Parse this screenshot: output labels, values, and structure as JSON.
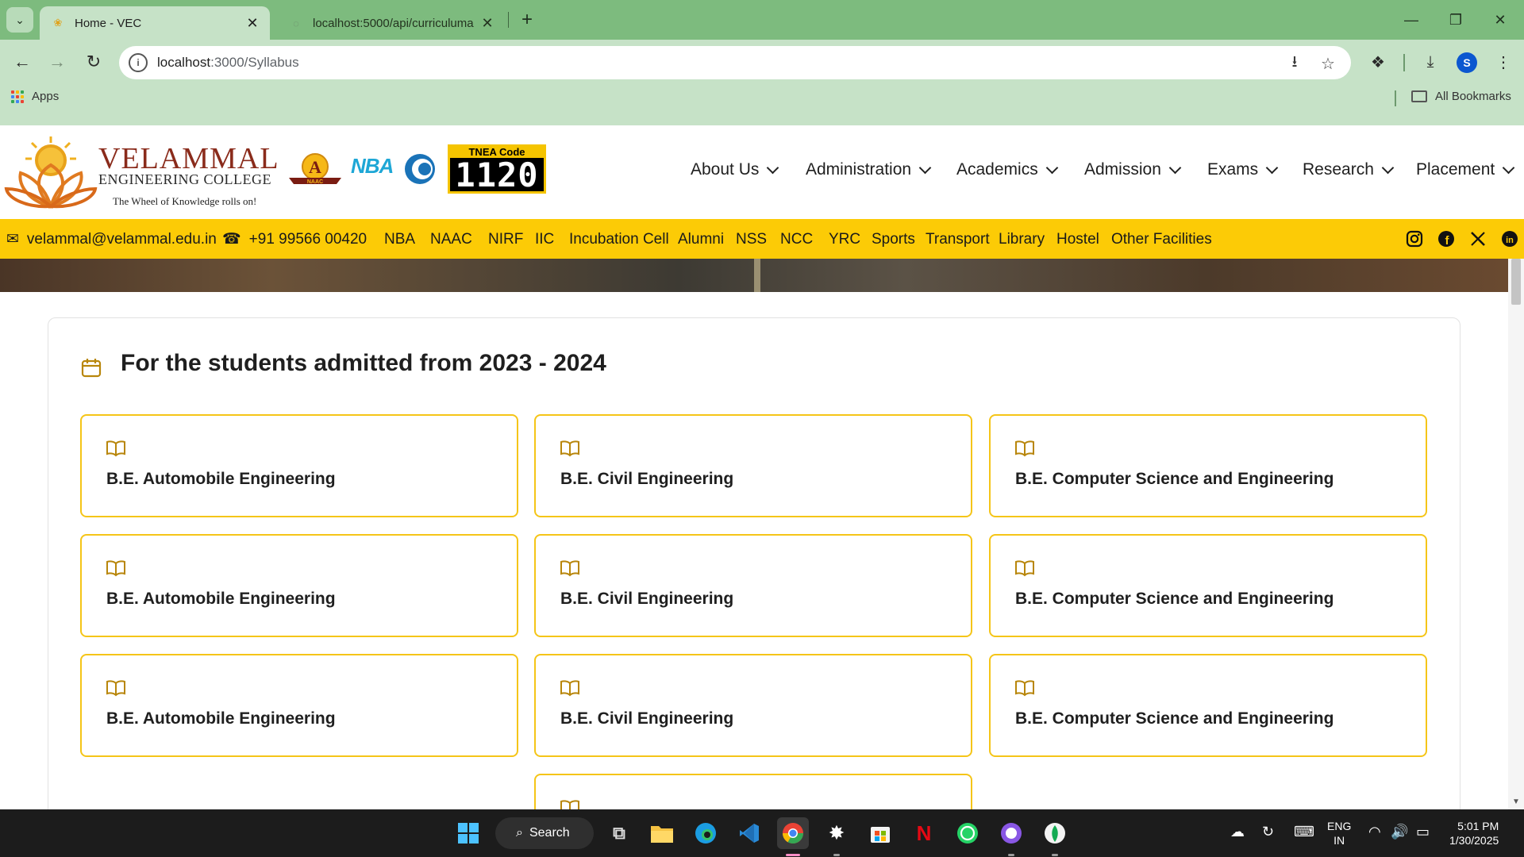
{
  "browser": {
    "tabs": [
      {
        "title": "Home - VEC",
        "active": true
      },
      {
        "title": "localhost:5000/api/curriculuma",
        "active": false
      }
    ],
    "url_host": "localhost",
    "url_path": ":3000/Syllabus",
    "bookmarks": {
      "apps_label": "Apps",
      "all_label": "All Bookmarks"
    },
    "profile_initial": "S"
  },
  "site": {
    "college_name": "VELAMMAL",
    "college_sub": "ENGINEERING COLLEGE",
    "tagline": "The Wheel of Knowledge rolls on!",
    "naac_label": "NAAC",
    "nba_label": "NBA",
    "tnea_label": "TNEA Code",
    "tnea_code": "1120",
    "nav": [
      "About Us",
      "Administration",
      "Academics",
      "Admission",
      "Exams",
      "Research",
      "Placement"
    ]
  },
  "infobar": {
    "email": "velammal@velammal.edu.in",
    "phone": "+91 99566 00420",
    "links": [
      "NBA",
      "NAAC",
      "NIRF",
      "IIC",
      "Incubation Cell",
      "Alumni",
      "NSS",
      "NCC",
      "YRC",
      "Sports",
      "Transport",
      "Library",
      "Hostel",
      "Other Facilities"
    ],
    "social": [
      "instagram-icon",
      "facebook-icon",
      "x-icon",
      "linkedin-icon"
    ]
  },
  "main": {
    "heading": "For the students admitted from 2023 - 2024",
    "courses": [
      "B.E. Automobile Engineering",
      "B.E. Civil Engineering",
      "B.E. Computer Science and Engineering",
      "B.E. Automobile Engineering",
      "B.E. Civil Engineering",
      "B.E. Computer Science and Engineering",
      "B.E. Automobile Engineering",
      "B.E. Civil Engineering",
      "B.E. Computer Science and Engineering",
      ""
    ]
  },
  "taskbar": {
    "search_label": "Search",
    "lang_line1": "ENG",
    "lang_line2": "IN",
    "time": "5:01 PM",
    "date": "1/30/2025"
  },
  "colors": {
    "accent_yellow": "#fccb06",
    "card_border": "#f5c518",
    "brand_red": "#8a2b1b",
    "chrome_green": "#7dbb7e"
  }
}
